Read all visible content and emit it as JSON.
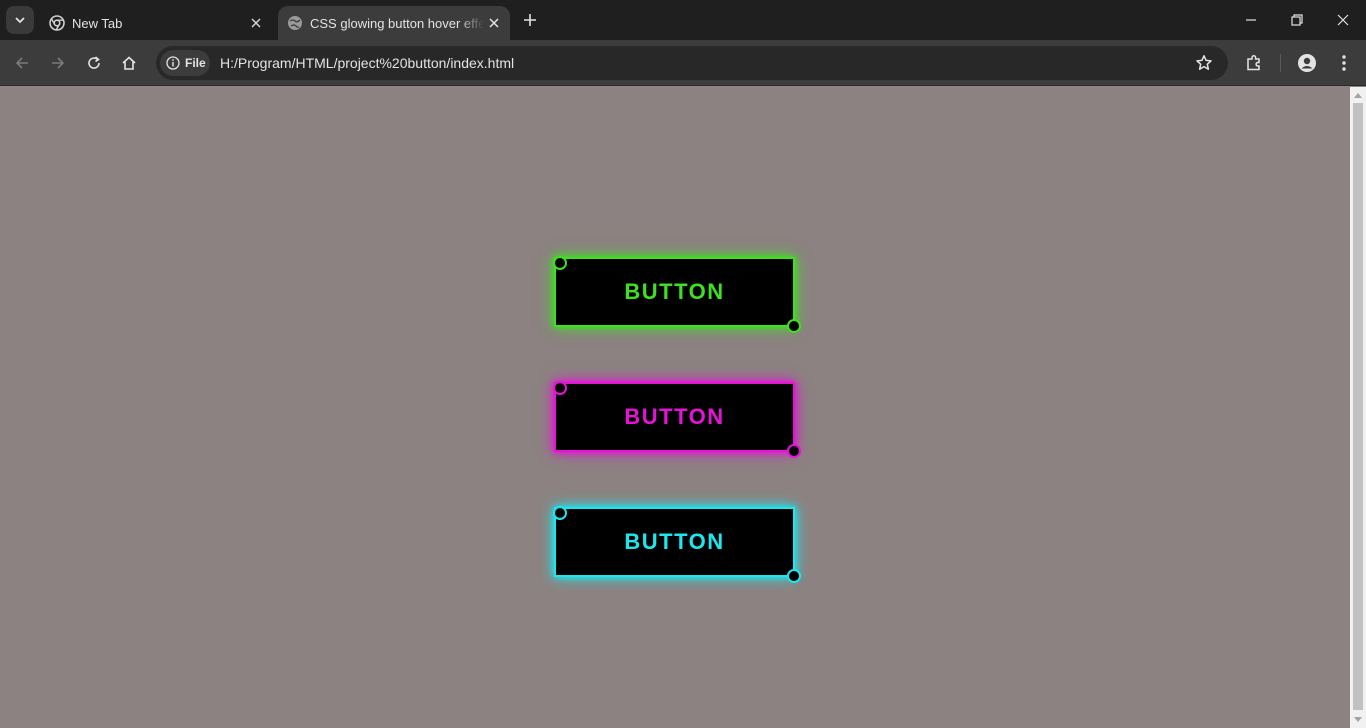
{
  "browser": {
    "tabs": [
      {
        "title": "New Tab",
        "icon": "chrome-icon",
        "active": false
      },
      {
        "title": "CSS glowing button hover effect",
        "icon": "globe-icon",
        "active": true
      }
    ],
    "address": {
      "chip_label": "File",
      "url": "H:/Program/HTML/project%20button/index.html"
    }
  },
  "page": {
    "background": "#8c8281",
    "buttons": [
      {
        "label": "BUTTON",
        "color": "#3fe021"
      },
      {
        "label": "BUTTON",
        "color": "#e612d8"
      },
      {
        "label": "BUTTON",
        "color": "#1de7ee"
      }
    ]
  }
}
